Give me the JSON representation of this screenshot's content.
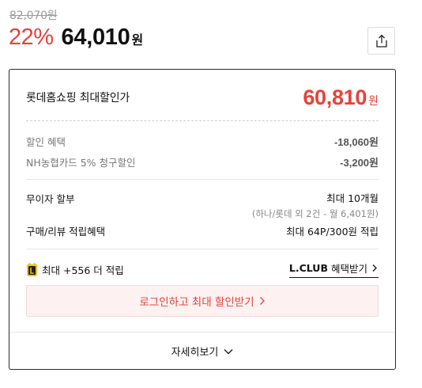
{
  "price": {
    "original": "82,070원",
    "discount_rate": "22%",
    "sale": "64,010",
    "unit": "원"
  },
  "icons": {
    "share": "share-icon",
    "club_badge": "lclub-badge-icon",
    "chevron_right": "chevron-right-icon",
    "chevron_down": "chevron-down-icon"
  },
  "colors": {
    "accent": "#e8413a",
    "login_bg": "#fdf1f1",
    "badge_gold": "#f2c21a"
  },
  "card": {
    "max_label": "롯데홈쇼핑 최대할인가",
    "max_price": "60,810",
    "max_unit": "원",
    "discounts": [
      {
        "label": "할인 혜택",
        "value": "-18,060원"
      },
      {
        "label": "NH농협카드 5% 청구할인",
        "value": "-3,200원"
      }
    ],
    "installment": {
      "label": "무이자 할부",
      "value": "최대 10개월",
      "sub": "(하나/롯데 외 2건 - 월 6,401원)"
    },
    "review": {
      "label": "구매/리뷰 적립혜택",
      "value": "최대 64P/300원 적립"
    },
    "club": {
      "text": "최대 +556 더 적립",
      "link_bold": "L.CLUB",
      "link_text": "혜택받기"
    },
    "login_button": "로그인하고 최대 할인받기",
    "more_button": "자세히보기"
  }
}
